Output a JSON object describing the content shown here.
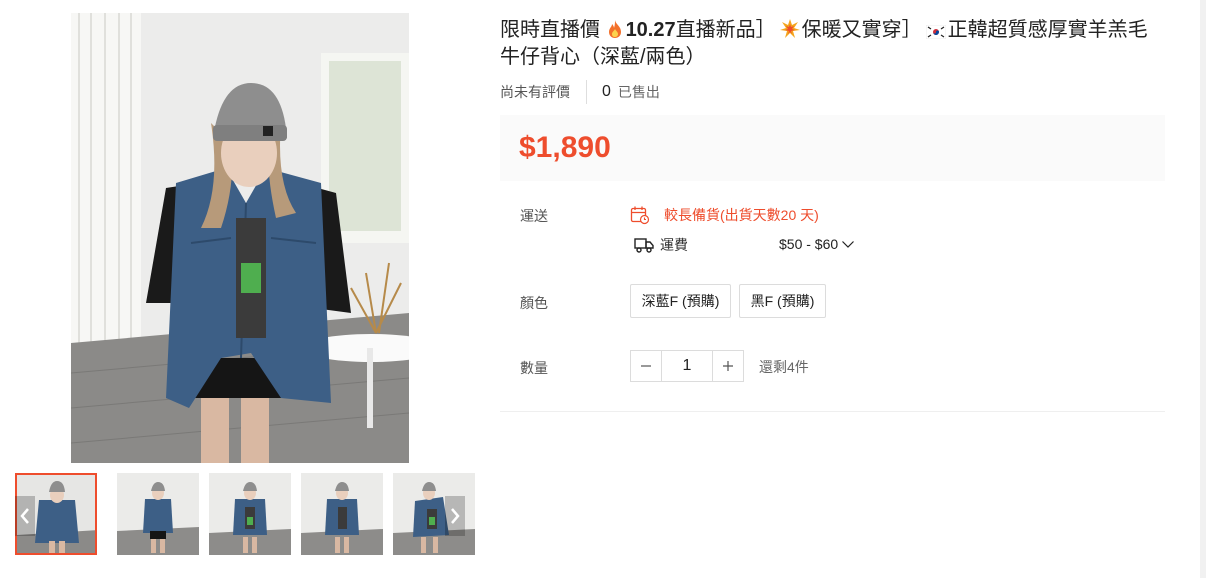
{
  "product": {
    "title_parts": {
      "p1": "限時直播價 ",
      "p2": "10.27",
      "p3": "直播新品］",
      "p4": "保暖又實穿］",
      "p5": "正韓超質感厚實羊羔毛牛仔背心（深藍/兩色）"
    },
    "rating_text": "尚未有評價",
    "sold_count": "0",
    "sold_label": "已售出",
    "price": "$1,890"
  },
  "shipping": {
    "label": "運送",
    "notice": "較長備貨(出貨天數20 天)",
    "fee_label": "運費",
    "fee_range": "$50 - $60"
  },
  "color": {
    "label": "顏色",
    "options": [
      "深藍F (預購)",
      "黑F (預購)"
    ]
  },
  "quantity": {
    "label": "數量",
    "value": "1",
    "stock": "還剩4件"
  },
  "theme": {
    "accent": "#ee4d2d",
    "price_bg": "#fafafa"
  },
  "icons": [
    "fire-icon",
    "collision-icon",
    "korea-flag-icon",
    "calendar-clock-icon",
    "truck-icon",
    "chevron-down-icon",
    "minus-icon",
    "plus-icon",
    "chevron-left-icon",
    "chevron-right-icon"
  ]
}
